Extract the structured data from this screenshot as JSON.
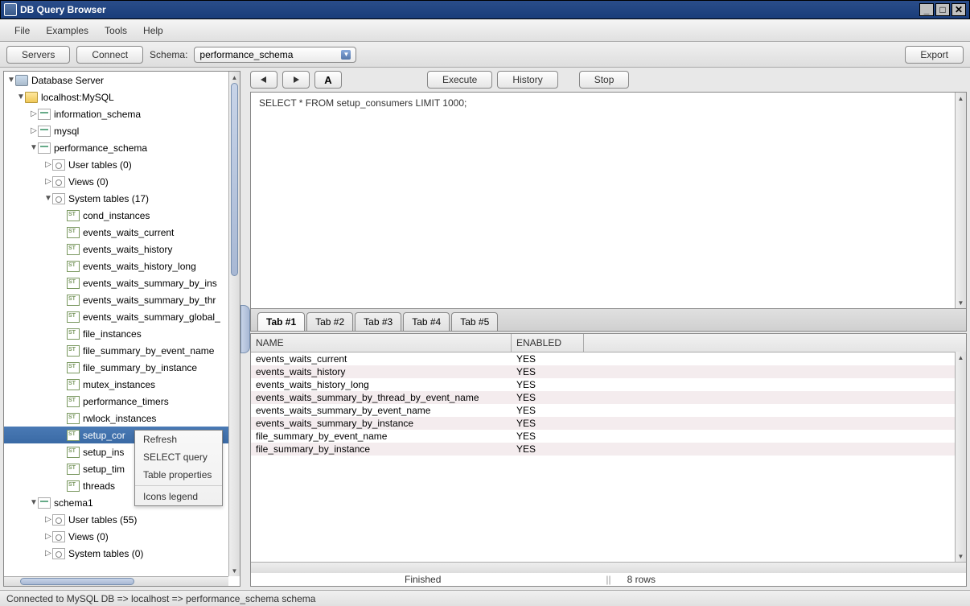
{
  "title": "DB Query Browser",
  "menu": [
    "File",
    "Examples",
    "Tools",
    "Help"
  ],
  "toolbar": {
    "servers_btn": "Servers",
    "connect_btn": "Connect",
    "schema_label": "Schema:",
    "schema_value": "performance_schema",
    "export_btn": "Export"
  },
  "query_toolbar": {
    "back": "←",
    "forward": "→",
    "font": "A",
    "execute": "Execute",
    "history": "History",
    "stop": "Stop"
  },
  "query_text": "SELECT * FROM setup_consumers LIMIT 1000;",
  "tabs": [
    "Tab #1",
    "Tab #2",
    "Tab #3",
    "Tab #4",
    "Tab #5"
  ],
  "active_tab_index": 0,
  "tree": {
    "root": "Database Server",
    "host": "localhost:MySQL",
    "schemas": [
      "information_schema",
      "mysql"
    ],
    "perf_schema": "performance_schema",
    "perf_children": {
      "user_tables": "User tables (0)",
      "views": "Views (0)",
      "system_tables": "System tables (17)",
      "tables": [
        "cond_instances",
        "events_waits_current",
        "events_waits_history",
        "events_waits_history_long",
        "events_waits_summary_by_ins",
        "events_waits_summary_by_thr",
        "events_waits_summary_global_",
        "file_instances",
        "file_summary_by_event_name",
        "file_summary_by_instance",
        "mutex_instances",
        "performance_timers",
        "rwlock_instances",
        "setup_cor",
        "setup_ins",
        "setup_tim",
        "threads"
      ],
      "selected_index": 13
    },
    "schema1": {
      "label": "schema1",
      "user_tables": "User tables (55)",
      "views": "Views (0)",
      "system_tables": "System tables (0)"
    }
  },
  "context_menu": {
    "items": [
      "Refresh",
      "SELECT query",
      "Table properties",
      "Icons legend"
    ]
  },
  "results": {
    "columns": [
      "NAME",
      "ENABLED"
    ],
    "rows": [
      {
        "name": "events_waits_current",
        "enabled": "YES"
      },
      {
        "name": "events_waits_history",
        "enabled": "YES"
      },
      {
        "name": "events_waits_history_long",
        "enabled": "YES"
      },
      {
        "name": "events_waits_summary_by_thread_by_event_name",
        "enabled": "YES"
      },
      {
        "name": "events_waits_summary_by_event_name",
        "enabled": "YES"
      },
      {
        "name": "events_waits_summary_by_instance",
        "enabled": "YES"
      },
      {
        "name": "file_summary_by_event_name",
        "enabled": "YES"
      },
      {
        "name": "file_summary_by_instance",
        "enabled": "YES"
      }
    ]
  },
  "status_row": {
    "finished": "Finished",
    "rows": "8 rows"
  },
  "statusbar": "Connected to MySQL DB => localhost => performance_schema schema"
}
